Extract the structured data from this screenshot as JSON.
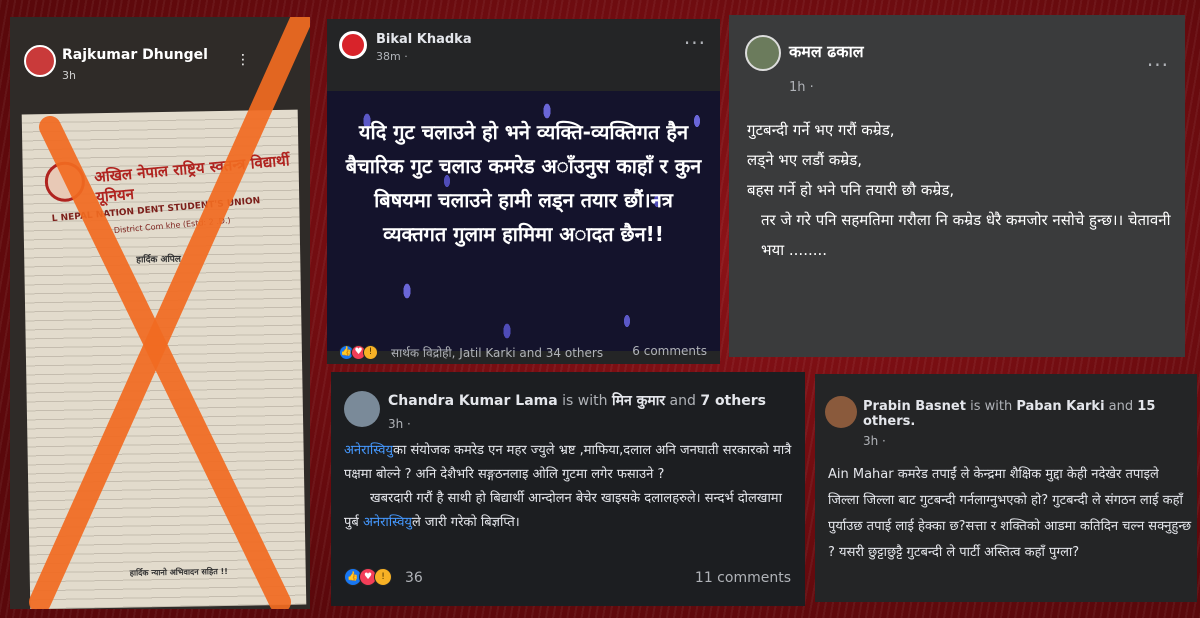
{
  "posts": {
    "rajkumar": {
      "author": "Rajkumar Dhungel",
      "time": "3h",
      "doc_header_np": "अखिल नेपाल राष्ट्रिय स्वतन्त्र विद्यार्थी यूनियन",
      "doc_header_en": "L NEPAL NATION    DENT STUDENT'S UNION",
      "doc_header_sub": "District Com    khe (Estd: 2    .D.)",
      "doc_title": "हार्दिक अपिल",
      "doc_footer": "हार्दिक न्यानो अभिवादन सहित !!"
    },
    "bikal": {
      "author": "Bikal Khadka",
      "time": "38m ·",
      "media_text": "यदि गुट चलाउने हो भने व्यक्ति-व्यक्तिगत हैन बैचारिक गुट चलाउ कमरेड अाँउनुस काहाँ र कुन बिषयमा चलाउने हामी लड्न तयार छौं।नत्र व्यक्तगत गुलाम हामिमा अादत छैन!!",
      "reactions_text": "सार्थक विद्रोही, Jatil Karki and 34 others",
      "comments": "6 comments"
    },
    "kamal": {
      "author": "कमल ढकाल",
      "time": "1h ·",
      "body_line1": "गुटबन्दी गर्ने भए गरौं कम्रेड,",
      "body_line2": "लड्ने भए लडौं कम्रेड,",
      "body_line3": "बहस गर्ने हो भने पनि तयारी छौ कम्रेड,",
      "body_line4": "तर जे गरे पनि सहमतिमा गरौला नि कम्रेड धेरै कमजोर नसोचे हुन्छ।। चेतावनी भया ........"
    },
    "chandra": {
      "author": "Chandra Kumar Lama",
      "with_text": "is with",
      "tagged": "मिन कुमार",
      "and_text": "and",
      "others": "7 others",
      "time": "3h ·",
      "link1": "अनेरास्वियु",
      "body1": "का संयोजक कमरेड एन महर ज्युले भ्रष्ट ,माफिया,दलाल अनि जनघाती सरकारको मात्रै पक्षमा बोल्ने ? अनि देशैभरि सङ्गठनलाइ ओलि गुटमा लगेर फसाउने ?",
      "body2": "खबरदारी गरौं है साथी हो बिद्यार्थी आन्दोलन बेचेर खाइसके दलालहरुले। सन्दर्भ दोलखामा पुर्ब",
      "link2": "अनेरास्वियु",
      "body3": "ले जारी गरेको बिज्ञप्ति।",
      "reaction_count": "36",
      "comments": "11 comments"
    },
    "prabin": {
      "author": "Prabin Basnet",
      "with_text": "is with",
      "tagged": "Paban Karki",
      "and_text": "and",
      "others": "15 others.",
      "time": "3h ·",
      "body": "Ain Mahar कमरेड तपाईं ले केन्द्रमा शैक्षिक मुद्दा केही नदेखेर तपाइले जिल्ला जिल्ला बाट गुटबन्दी गर्नलाग्नुभएको हो? गुटबन्दी ले संगठन लाई कहाँ पुर्याउछ तपाई लाई हेक्का छ?सत्ता र शक्तिको आडमा कतिदिन चल्न सक्नुहुन्छ ? यसरी छुट्टाछुट्टै गुटबन्दी ले पार्टी अस्तित्व कहाँ पुग्ला?"
    }
  },
  "colors": {
    "background": "#6e0d10",
    "cross": "#f26b21",
    "link": "#4599ff"
  }
}
